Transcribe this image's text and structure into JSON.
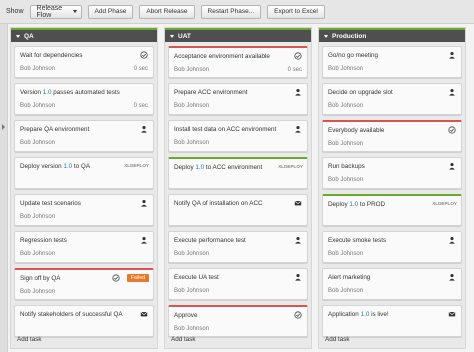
{
  "toolbar": {
    "show_label": "Show",
    "release_select": "Release Flow",
    "buttons": [
      "Add Phase",
      "Abort Release",
      "Restart Phase...",
      "Export to Excel"
    ]
  },
  "columns": [
    {
      "name": "QA",
      "add_task": "Add task",
      "tasks": [
        {
          "title": "Wait for dependencies",
          "owner": "Bob Johnson",
          "duration": "0 sec",
          "icon": "check-icon"
        },
        {
          "title_parts": [
            "Version ",
            "1.0",
            " passes automated tests"
          ],
          "owner": "Bob Johnson",
          "duration": "0 sec"
        },
        {
          "title": "Prepare QA environment",
          "owner": "Bob Johnson",
          "icon": "user-icon"
        },
        {
          "title_parts": [
            "Deploy version ",
            "1.0",
            " to QA"
          ],
          "icon_text": "XLDEPLOY"
        },
        {
          "title": "Update test scenarios",
          "owner": "Bob Johnson",
          "icon": "user-icon"
        },
        {
          "title": "Regression tests",
          "owner": "Bob Johnson",
          "icon": "user-icon"
        },
        {
          "title": "Sign off by QA",
          "owner": "Bob Johnson",
          "badge": "Failed",
          "icon": "check-icon",
          "state": "red"
        },
        {
          "title": "Notify stakeholders of successful QA",
          "icon": "mail-icon"
        }
      ]
    },
    {
      "name": "UAT",
      "add_task": "Add task",
      "tasks": [
        {
          "title": "Acceptance environment available",
          "owner": "Bob Johnson",
          "duration": "0 sec",
          "icon": "check-icon",
          "state": "red"
        },
        {
          "title": "Prepare ACC environment",
          "owner": "Bob Johnson",
          "icon": "user-icon"
        },
        {
          "title": "Install test data on ACC environment",
          "owner": "Bob Johnson",
          "icon": "user-icon"
        },
        {
          "title_parts": [
            "Deploy ",
            "1.0",
            " to ACC environment"
          ],
          "icon_text": "XLDEPLOY",
          "state": "green"
        },
        {
          "title": "Notify QA of installation on ACC",
          "icon": "mail-icon"
        },
        {
          "title": "Execute performance test",
          "owner": "Bob Johnson",
          "icon": "user-icon"
        },
        {
          "title": "Execute UA test",
          "owner": "Bob Johnson",
          "icon": "user-icon"
        },
        {
          "title": "Approve",
          "owner": "Bob Johnson",
          "icon": "check-icon",
          "state": "red"
        }
      ]
    },
    {
      "name": "Production",
      "add_task": "Add task",
      "tasks": [
        {
          "title": "Go/no go meeting",
          "owner": "Bob Johnson",
          "icon": "user-icon"
        },
        {
          "title": "Decide on upgrade slot",
          "owner": "Bob Johnson",
          "icon": "user-icon"
        },
        {
          "title": "Everybody available",
          "owner": "Bob Johnson",
          "icon": "check-icon",
          "state": "red"
        },
        {
          "title": "Run backups",
          "owner": "Bob Johnson",
          "icon": "user-icon"
        },
        {
          "title_parts": [
            "Deploy ",
            "1.0",
            " to PROD"
          ],
          "icon_text": "XLDEPLOY",
          "state": "green"
        },
        {
          "title": "Execute smoke tests",
          "owner": "Bob Johnson",
          "icon": "user-icon"
        },
        {
          "title": "Alert marketing",
          "owner": "Bob Johnson",
          "icon": "user-icon"
        },
        {
          "title_parts": [
            "Application ",
            "1.0",
            " is live!"
          ],
          "icon": "mail-icon"
        }
      ]
    }
  ],
  "colors": {
    "accent_green": "#6aaa2d",
    "accent_red": "#d9534f",
    "failed_badge": "#e8792b",
    "version_link": "#2a73b8"
  }
}
